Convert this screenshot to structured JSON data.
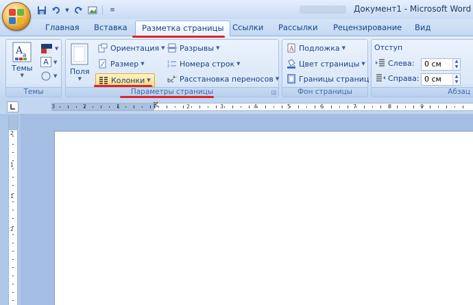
{
  "window": {
    "title": "Документ1 - Microsoft Word"
  },
  "quick_access": [
    {
      "name": "save-icon",
      "glyph": "💾"
    },
    {
      "name": "undo-icon",
      "glyph": "↶"
    },
    {
      "name": "redo-icon",
      "glyph": "↺"
    },
    {
      "name": "picture-icon",
      "glyph": "▣"
    },
    {
      "name": "customize-icon",
      "glyph": "⌄"
    }
  ],
  "tabs": [
    {
      "label": "Главная"
    },
    {
      "label": "Вставка"
    },
    {
      "label": "Разметка страницы",
      "active": true
    },
    {
      "label": "Ссылки"
    },
    {
      "label": "Рассылки"
    },
    {
      "label": "Рецензирование"
    },
    {
      "label": "Вид"
    }
  ],
  "groups": {
    "themes": {
      "label": "Темы",
      "button": "Темы"
    },
    "page_setup": {
      "label": "Параметры страницы",
      "margins": "Поля",
      "orientation": "Ориентация",
      "size": "Размер",
      "columns": "Колонки",
      "breaks": "Разрывы",
      "line_numbers": "Номера строк",
      "hyphenation": "Расстановка переносов"
    },
    "page_background": {
      "label": "Фон страницы",
      "watermark": "Подложка",
      "page_color": "Цвет страницы",
      "page_borders": "Границы страниц"
    },
    "paragraph": {
      "label": "Абзац",
      "indent_title": "Отступ",
      "left_label": "Слева:",
      "left_value": "0 см",
      "right_label": "Справа:",
      "right_value": "0 см"
    }
  },
  "ruler": {
    "h_numbers": [
      "3",
      "2",
      "1",
      "1",
      "2",
      "3",
      "4",
      "5",
      "6",
      "7",
      "8",
      "9"
    ],
    "v_numbers": [
      "2",
      "1",
      "1",
      "2"
    ]
  },
  "colors": {
    "highlight_red": "#e0202a",
    "ribbon_text": "#15428b",
    "accent_gold": "#f4c14f"
  }
}
